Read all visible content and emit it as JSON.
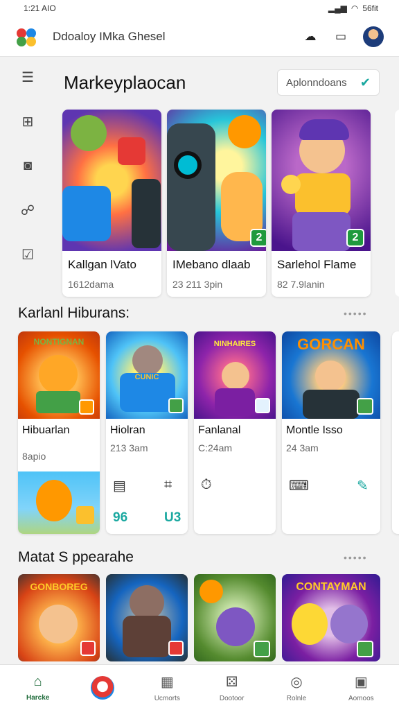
{
  "status": {
    "time": "1:21 AIO",
    "right": "56fit"
  },
  "app": {
    "title": "Ddoaloy IMka Ghesel"
  },
  "header": {
    "section_title": "Markeyplaocan",
    "dropdown_value": "Aplonndoans"
  },
  "featured": [
    {
      "name": "Kallgan lVato",
      "meta": "1612dama",
      "badge": ""
    },
    {
      "name": "IMebano dlaab",
      "meta": "23 211 3pin",
      "badge": "2"
    },
    {
      "name": "Sarlehol Flame",
      "meta": "82 7.9lanin",
      "badge": "2"
    }
  ],
  "section2": {
    "title": "Karlanl Hiburans:",
    "more": "•••••"
  },
  "cards": [
    {
      "art_text": "NONTIGNAN",
      "title": "Hibuarlan",
      "sub": "",
      "sub2": "8apio",
      "icon_a": "",
      "icon_b": ""
    },
    {
      "art_text": "CUNIC",
      "title": "Hiolran",
      "sub": "213 3am",
      "sub2": "",
      "icon_a": "▤",
      "icon_b": "96"
    },
    {
      "art_text": "NINHAIRES",
      "title": "Fanlanal",
      "sub": "C:24am",
      "sub2": "",
      "icon_a": "⏱",
      "icon_b": ""
    },
    {
      "art_text": "GORCAN",
      "title": "Montle Isso",
      "sub": "24 3am",
      "sub2": "",
      "icon_a": "⌨",
      "icon_b": ""
    }
  ],
  "section3": {
    "title": "Matat S ppearahe",
    "more": "•••••"
  },
  "tiles": [
    {
      "art_text": "GONBOREG"
    },
    {
      "art_text": ""
    },
    {
      "art_text": ""
    },
    {
      "art_text": "CONTAYMAN"
    }
  ],
  "nav": [
    {
      "label": "Harcke",
      "icon": "⌂",
      "active": true
    },
    {
      "label": "",
      "icon": "",
      "active": false
    },
    {
      "label": "Ucmorts",
      "icon": "▦",
      "active": false
    },
    {
      "label": "Dootoor",
      "icon": "⚄",
      "active": false
    },
    {
      "label": "Rolnle",
      "icon": "◎",
      "active": false
    },
    {
      "label": "Aomoos",
      "icon": "▣",
      "active": false
    }
  ]
}
